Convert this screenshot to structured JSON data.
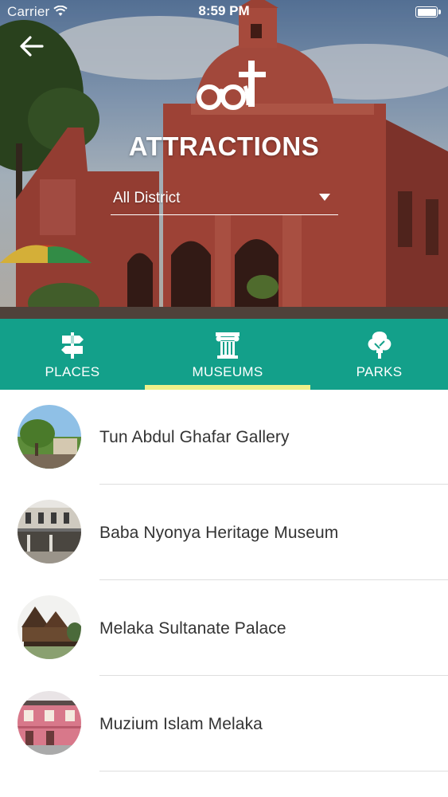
{
  "status_bar": {
    "carrier": "Carrier",
    "time": "8:59 PM",
    "battery_level": 1.0
  },
  "header": {
    "back_icon": "arrow-left-icon",
    "logo_icon": "glasses-cross-logo-icon",
    "title": "ATTRACTIONS",
    "district_select": {
      "value": "All District",
      "icon": "caret-down-icon"
    }
  },
  "tabs": {
    "selected": "MUSEUMS",
    "background": "#13a08a",
    "indicator_color": "#eef08a",
    "items": [
      {
        "label": "PLACES",
        "icon": "signpost-icon"
      },
      {
        "label": "MUSEUMS",
        "icon": "museum-column-icon"
      },
      {
        "label": "PARKS",
        "icon": "tree-icon"
      }
    ]
  },
  "list": {
    "items": [
      {
        "label": "Tun Abdul Ghafar Gallery",
        "thumbnail": "gallery-photo"
      },
      {
        "label": "Baba Nyonya Heritage Museum",
        "thumbnail": "heritage-museum-photo"
      },
      {
        "label": "Melaka Sultanate Palace",
        "thumbnail": "palace-photo"
      },
      {
        "label": "Muzium Islam Melaka",
        "thumbnail": "islamic-museum-photo"
      }
    ]
  }
}
